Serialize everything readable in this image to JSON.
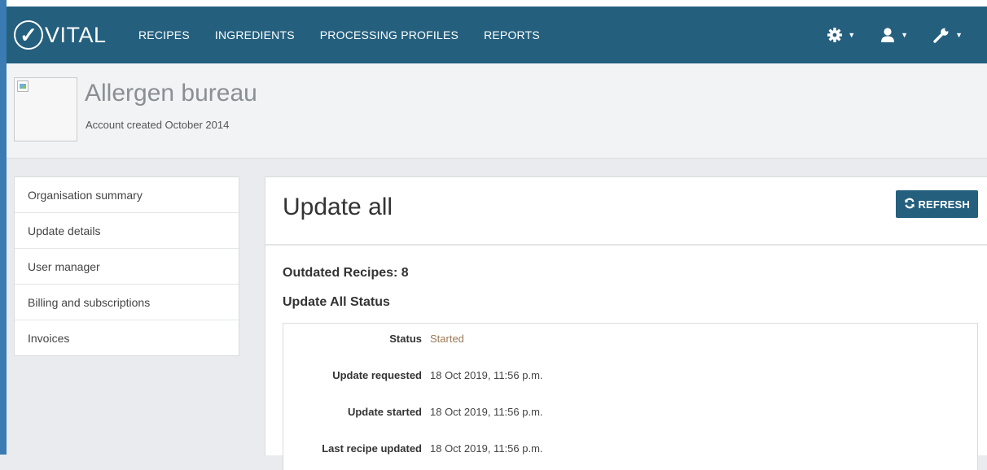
{
  "brand": {
    "name": "VITAL",
    "check_glyph": "✓"
  },
  "nav": {
    "links": [
      "RECIPES",
      "INGREDIENTS",
      "PROCESSING PROFILES",
      "REPORTS"
    ],
    "tools": [
      {
        "icon": "gear-icon"
      },
      {
        "icon": "user-icon"
      },
      {
        "icon": "wrench-icon"
      }
    ]
  },
  "organisation": {
    "name": "Allergen bureau",
    "created": "Account created October 2014"
  },
  "sidebar": {
    "items": [
      {
        "label": "Organisation summary"
      },
      {
        "label": "Update details"
      },
      {
        "label": "User manager"
      },
      {
        "label": "Billing and subscriptions"
      },
      {
        "label": "Invoices"
      }
    ]
  },
  "main": {
    "title": "Update all",
    "refresh_label": "REFRESH",
    "outdated": "Outdated Recipes: 8",
    "status_heading": "Update All Status",
    "status_rows": [
      {
        "label": "Status",
        "value": "Started"
      },
      {
        "label": "Update requested",
        "value": "18 Oct 2019, 11:56 p.m."
      },
      {
        "label": "Update started",
        "value": "18 Oct 2019, 11:56 p.m."
      },
      {
        "label": "Last recipe updated",
        "value": "18 Oct 2019, 11:56 p.m."
      }
    ]
  },
  "colors": {
    "navbar": "#245f7e",
    "status_started": "#9a7a56",
    "accent_edge": "#3a7bb4"
  }
}
